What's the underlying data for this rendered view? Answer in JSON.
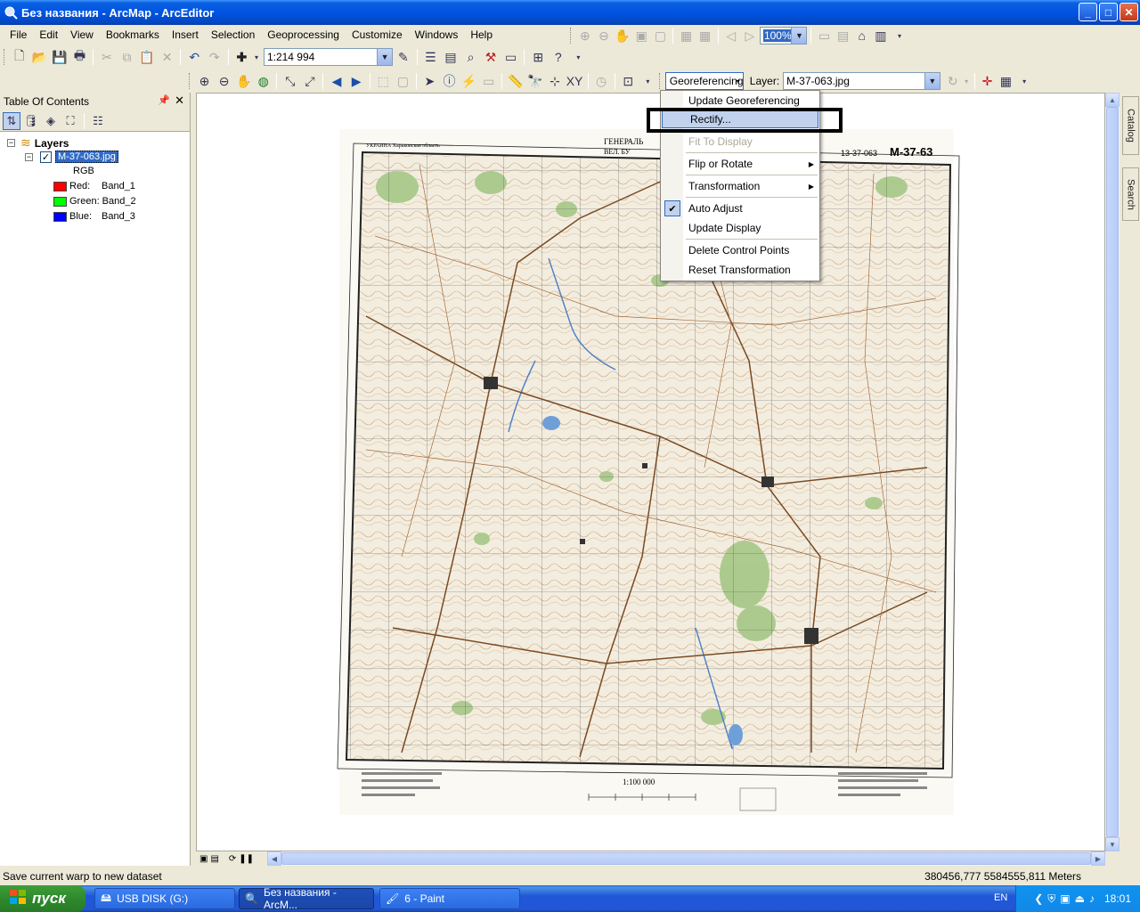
{
  "window": {
    "title": "Без названия - ArcMap - ArcEditor",
    "min": "_",
    "max": "□",
    "close": "✕"
  },
  "menu": [
    "File",
    "Edit",
    "View",
    "Bookmarks",
    "Insert",
    "Selection",
    "Geoprocessing",
    "Customize",
    "Windows",
    "Help"
  ],
  "toolbar": {
    "scale": "1:214 994",
    "zoom_percent": "100%"
  },
  "georef": {
    "label": "Georeferencing",
    "layer_label": "Layer:",
    "layer_value": "M-37-063.jpg"
  },
  "toc": {
    "title": "Table Of Contents",
    "layers_label": "Layers",
    "layer_name": "M-37-063.jpg",
    "rgb": "RGB",
    "bands": [
      {
        "channel": "Red:",
        "band": "Band_1",
        "color": "#ff0000"
      },
      {
        "channel": "Green:",
        "band": "Band_2",
        "color": "#00ff00"
      },
      {
        "channel": "Blue:",
        "band": "Band_3",
        "color": "#0000ff"
      }
    ]
  },
  "dropdown": {
    "items": [
      {
        "label": "Update Georeferencing",
        "state": "normal"
      },
      {
        "label": "Rectify...",
        "state": "highlighted"
      },
      {
        "label": "Fit To Display",
        "state": "disabled"
      },
      {
        "label": "Flip or Rotate",
        "state": "submenu"
      },
      {
        "label": "Transformation",
        "state": "submenu"
      },
      {
        "label": "Auto Adjust",
        "state": "checked"
      },
      {
        "label": "Update Display",
        "state": "normal"
      },
      {
        "label": "Delete Control Points",
        "state": "normal"
      },
      {
        "label": "Reset Transformation",
        "state": "normal"
      }
    ]
  },
  "map": {
    "sheet_id": "M-37-63",
    "sheet_id_small": "13-37-063",
    "scale_text": "1:100 000",
    "header_left": "ГЕНЕРАЛЬ",
    "header_left2": "ВЕЛ. БУ",
    "region": "УКРАИНА Харьковская область"
  },
  "side_tabs": [
    "Catalog",
    "Search"
  ],
  "status": {
    "message": "Save current warp to new dataset",
    "coords": "380456,777  5584555,811 Meters"
  },
  "taskbar": {
    "start": "пуск",
    "tasks": [
      "USB DISK (G:)",
      "Без названия - ArcM...",
      "6 - Paint"
    ],
    "lang": "EN",
    "clock": "18:01"
  }
}
